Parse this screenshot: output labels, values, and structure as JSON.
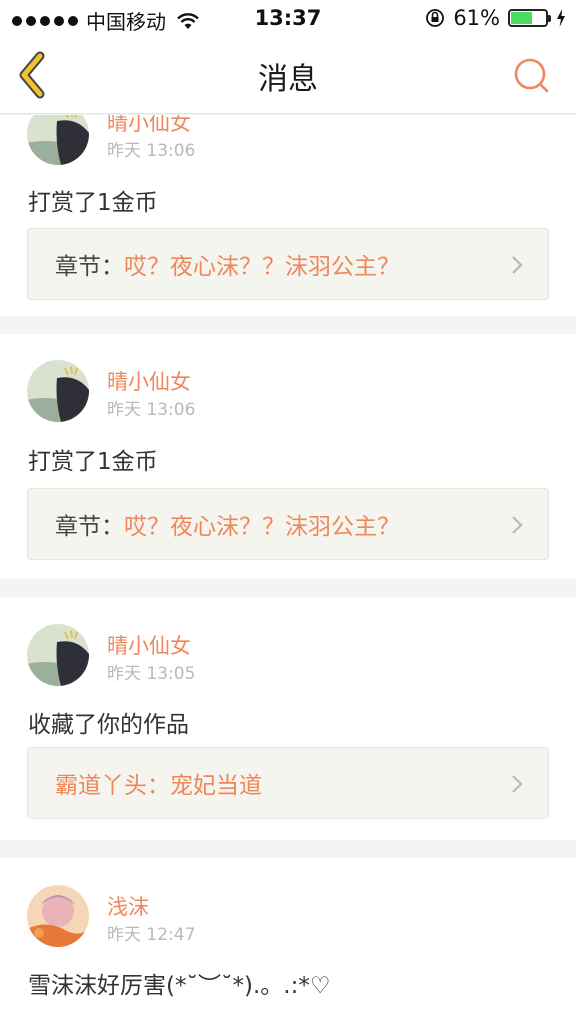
{
  "status_bar": {
    "carrier": "中国移动",
    "time": "13:37",
    "battery_percent": "61%",
    "battery_level": 0.61
  },
  "nav": {
    "title": "消息"
  },
  "colors": {
    "accent": "#f0875a",
    "back_arrow": "#f1c232",
    "background": "#f4f4f2"
  },
  "icons": [
    "back-arrow-icon",
    "search-icon",
    "chevron-right-icon",
    "wifi-icon",
    "lock-rotation-icon",
    "charging-icon"
  ],
  "messages": [
    {
      "user": "晴小仙女",
      "time": "昨天 13:06",
      "text": "打赏了1金币",
      "ref_label": "章节：",
      "ref_value": "哎？夜心沫？？沫羽公主？"
    },
    {
      "user": "晴小仙女",
      "time": "昨天 13:06",
      "text": "打赏了1金币",
      "ref_label": "章节：",
      "ref_value": "哎？夜心沫？？沫羽公主？"
    },
    {
      "user": "晴小仙女",
      "time": "昨天 13:05",
      "text": "收藏了你的作品",
      "ref_full": "霸道丫头：宠妃当道"
    },
    {
      "user": "浅沫",
      "time": "昨天 12:47",
      "text": "雪沫沫好厉害(*˘︶˘*).。.:*♡"
    }
  ]
}
